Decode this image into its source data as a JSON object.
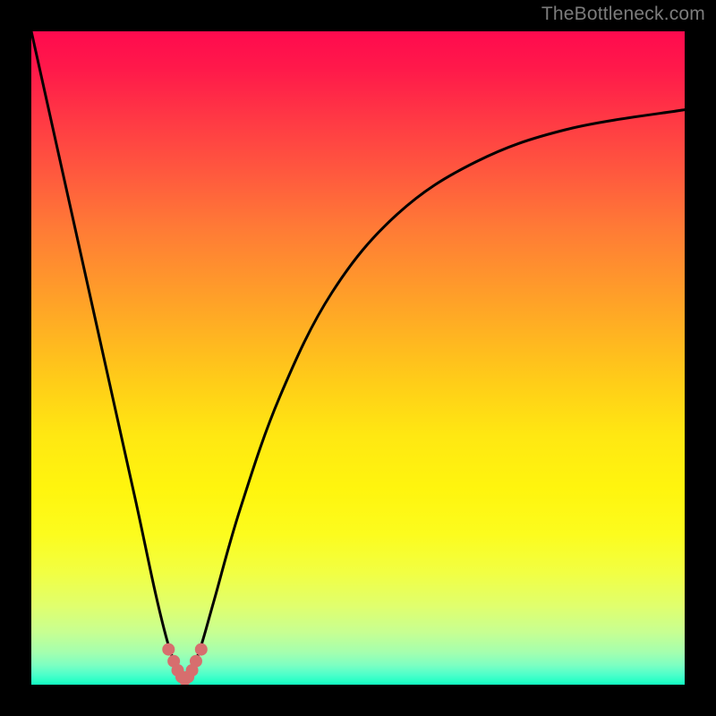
{
  "watermark": "TheBottleneck.com",
  "chart_data": {
    "type": "line",
    "title": "",
    "xlabel": "",
    "ylabel": "",
    "xlim": [
      0,
      100
    ],
    "ylim": [
      0,
      100
    ],
    "grid": false,
    "legend": false,
    "series": [
      {
        "name": "bottleneck-curve",
        "x": [
          0,
          4,
          8,
          12,
          16,
          19,
          21,
          22.5,
          23.5,
          24.5,
          26,
          28,
          32,
          38,
          46,
          56,
          68,
          82,
          100
        ],
        "y": [
          100,
          82,
          64,
          46,
          28,
          14,
          6,
          2,
          0,
          2,
          6,
          13,
          27,
          44,
          60,
          72,
          80,
          85,
          88
        ],
        "color": "#000000",
        "width": 3
      }
    ],
    "markers": {
      "name": "trough-dots",
      "color": "#d76e6e",
      "radius": 7,
      "points": [
        {
          "x": 21.0,
          "y": 5.4
        },
        {
          "x": 21.8,
          "y": 3.6
        },
        {
          "x": 22.4,
          "y": 2.2
        },
        {
          "x": 23.0,
          "y": 1.2
        },
        {
          "x": 23.5,
          "y": 0.8
        },
        {
          "x": 24.0,
          "y": 1.2
        },
        {
          "x": 24.6,
          "y": 2.2
        },
        {
          "x": 25.2,
          "y": 3.6
        },
        {
          "x": 26.0,
          "y": 5.4
        }
      ]
    },
    "gradient": {
      "direction": "top-to-bottom",
      "stops": [
        {
          "pos": 0.0,
          "color": "#ff0a4e"
        },
        {
          "pos": 0.5,
          "color": "#ffce18"
        },
        {
          "pos": 0.78,
          "color": "#fcfc1e"
        },
        {
          "pos": 1.0,
          "color": "#13ffc3"
        }
      ]
    }
  }
}
